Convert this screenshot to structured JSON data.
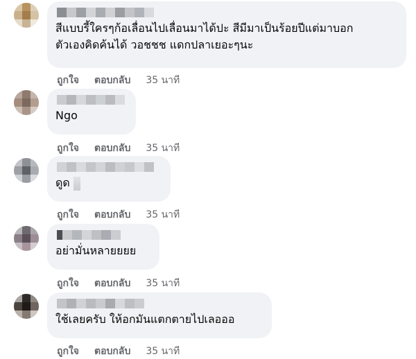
{
  "comments": [
    {
      "text": "สีแบบรี้ใครๆก้อเลื่อนไปเลื่อนมาได้ปะ สีมีมาเป็นร้อยปีแต่มาบอก\nตัวเองคิดค้นได้ วอชชช แดกปลาเยอะๆนะ",
      "like": "ถูกใจ",
      "reply": "ตอบกลับ",
      "time": "35 นาที"
    },
    {
      "text": "Ngo",
      "like": "ถูกใจ",
      "reply": "ตอบกลับ",
      "time": "35 นาที"
    },
    {
      "text": "ดูด",
      "like": "ถูกใจ",
      "reply": "ตอบกลับ",
      "time": "35 นาที"
    },
    {
      "text": "อย่ามั่นหลายยยย",
      "like": "ถูกใจ",
      "reply": "ตอบกลับ",
      "time": "35 นาที"
    },
    {
      "text": "ใช้เลยครับ ให้อกมันแตกตายไปเลอออ",
      "like": "ถูกใจ",
      "reply": "ตอบกลับ",
      "time": "35 นาที"
    }
  ],
  "colors": {
    "bubble": "#f0f2f5",
    "text": "#050505",
    "meta": "#65676b"
  }
}
